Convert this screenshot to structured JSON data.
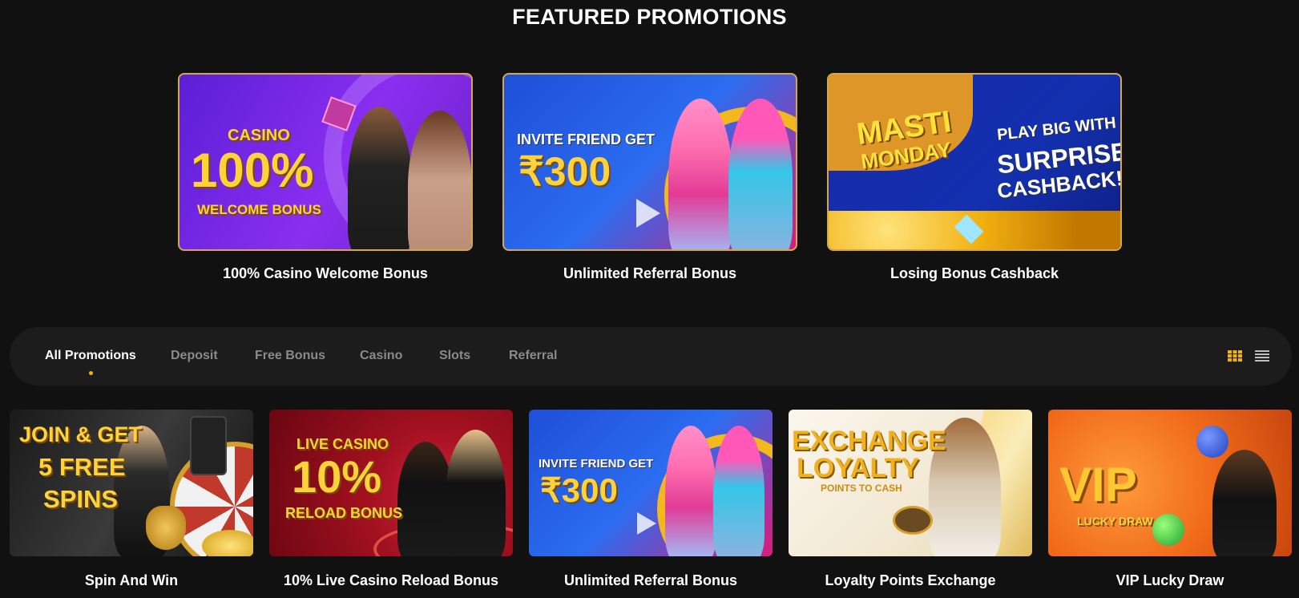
{
  "page": {
    "title": "FEATURED PROMOTIONS"
  },
  "featured": [
    {
      "label": "100% Casino Welcome Bonus",
      "banner": {
        "line1": "CASINO",
        "line2": "100%",
        "line3": "WELCOME BONUS"
      }
    },
    {
      "label": "Unlimited Referral Bonus",
      "banner": {
        "line1": "INVITE FRIEND GET",
        "line2": "₹300"
      }
    },
    {
      "label": "Losing Bonus Cashback",
      "banner": {
        "line1": "MASTI",
        "line2": "MONDAY",
        "line3": "PLAY BIG WITH",
        "line4": "SURPRISE",
        "line5": "CASHBACK!"
      }
    }
  ],
  "filters": {
    "tabs": [
      "All Promotions",
      "Deposit",
      "Free Bonus",
      "Casino",
      "Slots",
      "Referral"
    ],
    "active": "All Promotions",
    "grid_icon": "grid-view-icon",
    "list_icon": "list-view-icon",
    "accent": "#f5b400"
  },
  "promotions": [
    {
      "label": "Spin And Win",
      "banner": {
        "line1": "JOIN & GET",
        "line2": "5 FREE",
        "line3": "SPINS"
      }
    },
    {
      "label": "10% Live Casino Reload Bonus",
      "banner": {
        "line1": "LIVE CASINO",
        "line2": "10%",
        "line3": "RELOAD BONUS"
      }
    },
    {
      "label": "Unlimited Referral Bonus",
      "banner": {
        "line1": "INVITE FRIEND GET",
        "line2": "₹300"
      }
    },
    {
      "label": "Loyalty Points Exchange",
      "banner": {
        "line1": "EXCHANGE",
        "line2": "LOYALTY",
        "line3": "POINTS TO CASH"
      }
    },
    {
      "label": "VIP Lucky Draw",
      "banner": {
        "line1": "VIP",
        "line2": "LUCKY DRAW"
      }
    }
  ]
}
